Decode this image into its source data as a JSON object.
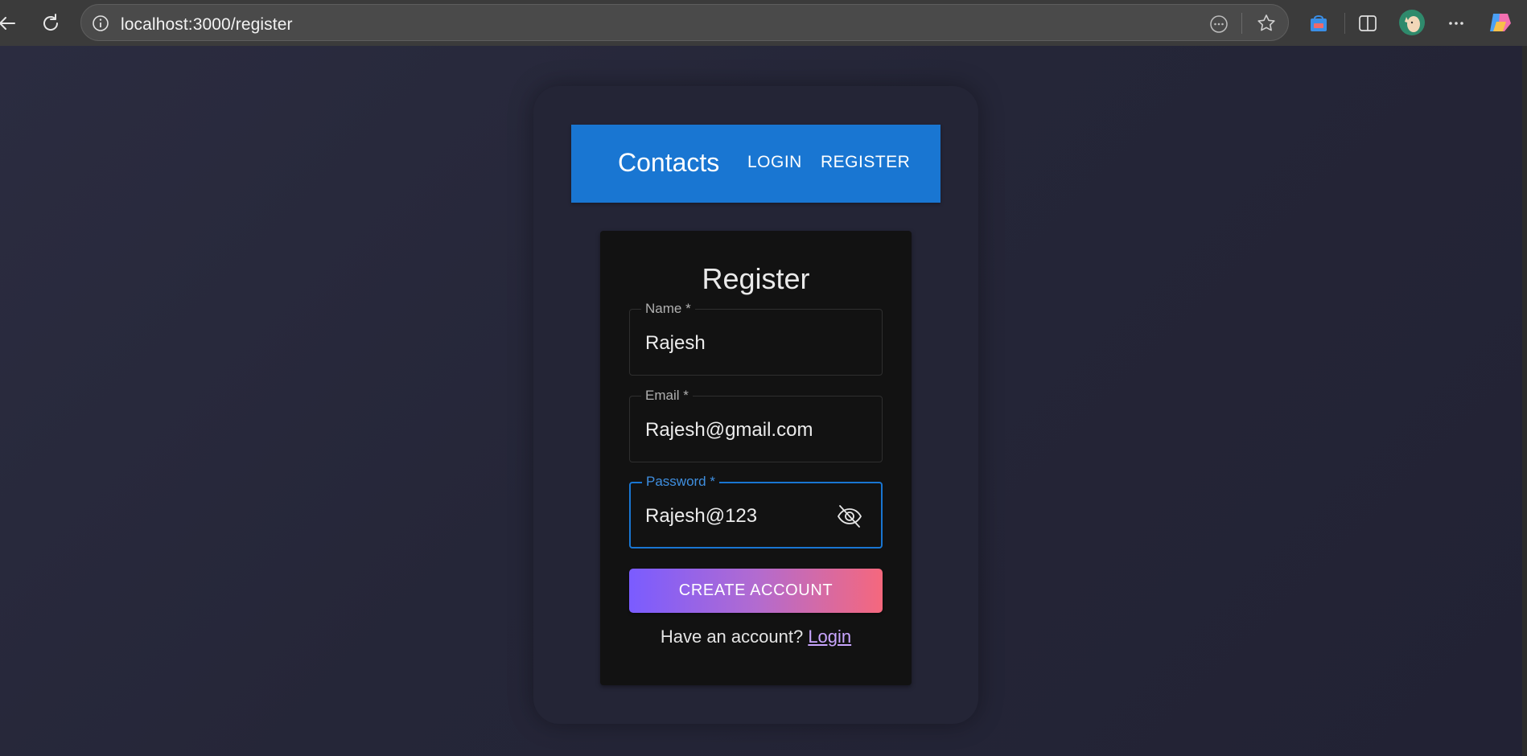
{
  "browser": {
    "url": "localhost:3000/register",
    "icons": [
      "back-icon",
      "refresh-icon",
      "info-icon",
      "more-icon",
      "star-icon",
      "shopping-icon",
      "split-screen-icon",
      "profile-avatar",
      "ellipsis-icon",
      "copilot-icon"
    ]
  },
  "appbar": {
    "brand": "Contacts",
    "login_label": "LOGIN",
    "register_label": "REGISTER",
    "color": "#1976d2"
  },
  "form": {
    "title": "Register",
    "name": {
      "label": "Name *",
      "value": "Rajesh"
    },
    "email": {
      "label": "Email *",
      "value": "Rajesh@gmail.com"
    },
    "password": {
      "label": "Password *",
      "value": "Rajesh@123",
      "visibility_icon": "eye-off-icon"
    },
    "submit_label": "CREATE ACCOUNT",
    "footer_text": "Have an account?",
    "footer_link": "Login"
  }
}
